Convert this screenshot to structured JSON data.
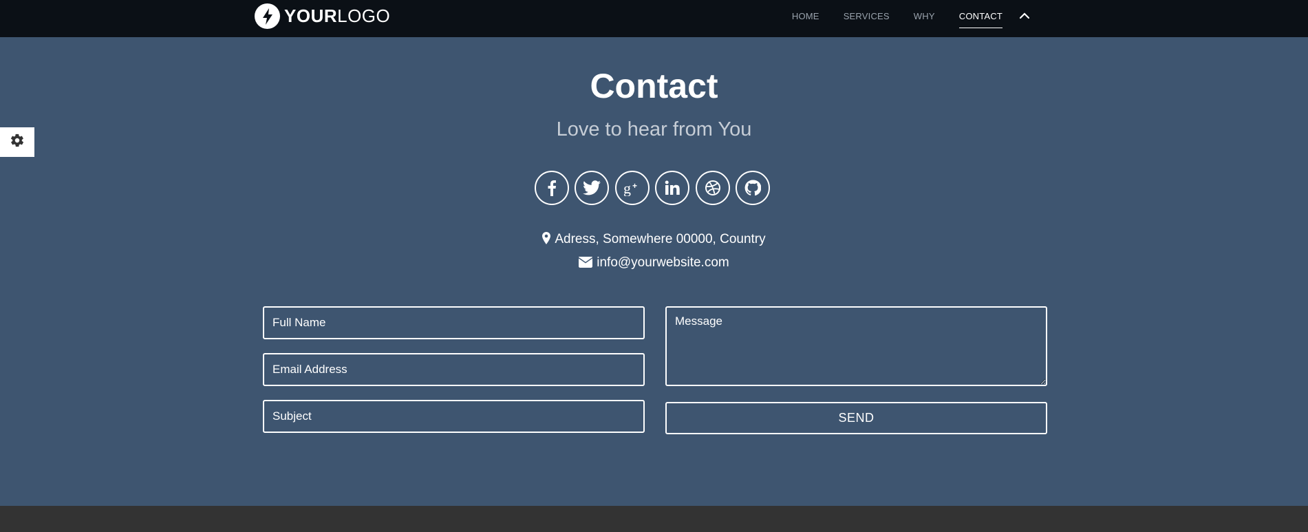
{
  "brand": {
    "logo_bold": "YOUR",
    "logo_light": "LOGO"
  },
  "nav": {
    "items": [
      {
        "label": "HOME",
        "active": false
      },
      {
        "label": "SERVICES",
        "active": false
      },
      {
        "label": "WHY",
        "active": false
      },
      {
        "label": "CONTACT",
        "active": true
      }
    ],
    "caret_icon": "chevron-up-icon"
  },
  "settings": {
    "icon": "gear-icon"
  },
  "section": {
    "title": "Contact",
    "subtitle": "Love to hear from You"
  },
  "social": [
    "facebook-icon",
    "twitter-icon",
    "google-plus-icon",
    "linkedin-icon",
    "dribbble-icon",
    "github-icon"
  ],
  "contact": {
    "address": "Adress, Somewhere 00000, Country",
    "email": "info@yourwebsite.com"
  },
  "form": {
    "name_placeholder": "Full Name",
    "email_placeholder": "Email Address",
    "subject_placeholder": "Subject",
    "message_placeholder": "Message",
    "send_label": "SEND"
  },
  "colors": {
    "background": "#3e5570",
    "topbar": "#0b1016",
    "footer": "#333333",
    "subtitle": "#c6cdd6",
    "nav_inactive": "#9aa3ad"
  }
}
